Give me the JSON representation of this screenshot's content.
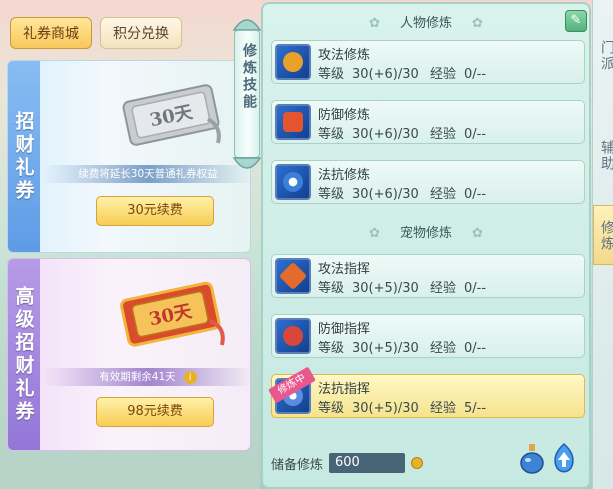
{
  "left_panel": {
    "tabs": [
      {
        "label": "礼券商城",
        "active": true
      },
      {
        "label": "积分兑换",
        "active": false
      }
    ],
    "cards": [
      {
        "vertical_label": "招财礼券",
        "ticket_text": "30天",
        "info_text": "续费将延长30天普通礼券权益",
        "button_label": "30元续费",
        "has_info_icon": false
      },
      {
        "vertical_label": "高级招财礼券",
        "ticket_text": "30天",
        "info_text": "有效期剩余41天",
        "button_label": "98元续费",
        "has_info_icon": true
      }
    ]
  },
  "divider": {
    "label": "修炼技能"
  },
  "skills_panel": {
    "section_person": "人物修炼",
    "section_pet": "宠物修炼",
    "level_label": "等级",
    "exp_label": "经验",
    "person_skills": [
      {
        "name": "攻法修炼",
        "level": "30(+6)/30",
        "exp": "0/--",
        "icon": "attack-icon"
      },
      {
        "name": "防御修炼",
        "level": "30(+6)/30",
        "exp": "0/--",
        "icon": "defense-icon"
      },
      {
        "name": "法抗修炼",
        "level": "30(+6)/30",
        "exp": "0/--",
        "icon": "resist-icon"
      }
    ],
    "pet_skills": [
      {
        "name": "攻法指挥",
        "level": "30(+5)/30",
        "exp": "0/--",
        "icon": "pet-attack-icon"
      },
      {
        "name": "防御指挥",
        "level": "30(+5)/30",
        "exp": "0/--",
        "icon": "pet-defense-icon"
      },
      {
        "name": "法抗指挥",
        "level": "30(+5)/30",
        "exp": "5/--",
        "icon": "pet-resist-icon",
        "ribbon": "修炼中",
        "selected": true
      }
    ],
    "reserve_label": "储备修炼",
    "reserve_value": "600"
  },
  "right_strip": {
    "items": [
      "门派",
      "辅助",
      "修炼"
    ]
  },
  "colors": {
    "accent_gold": "#f7c85d",
    "panel_green": "#c6e9e1",
    "selected_row": "#f5e38e",
    "ribbon_pink": "#e9588d"
  }
}
